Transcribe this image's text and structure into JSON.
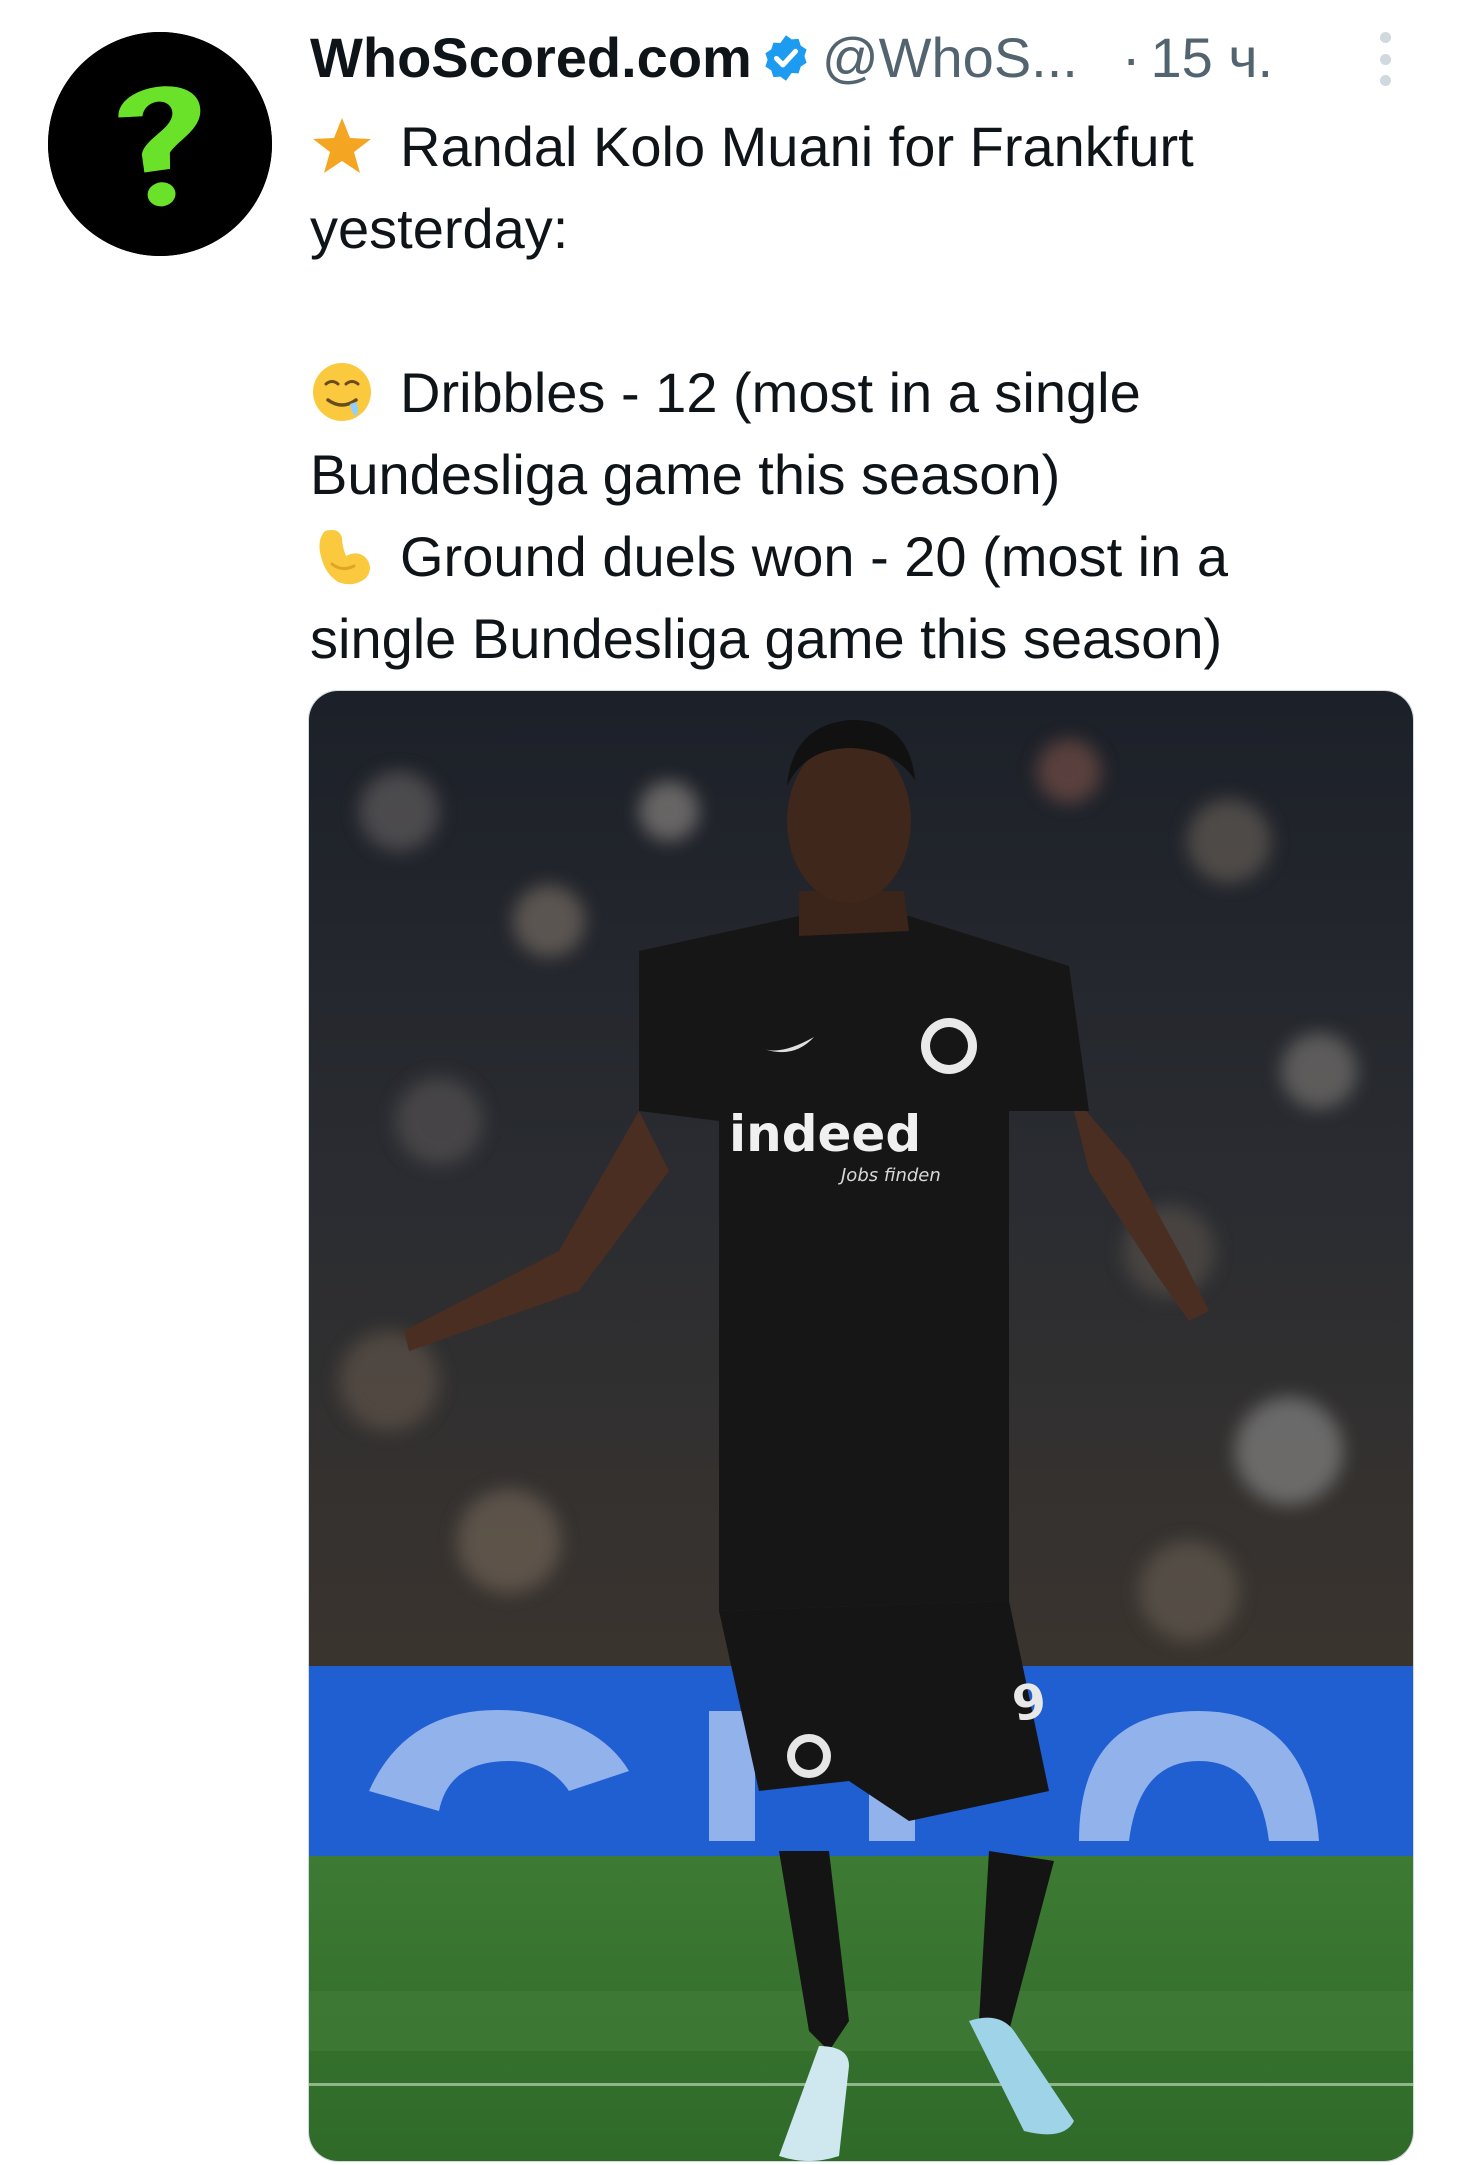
{
  "tweet": {
    "author": {
      "display_name": "WhoScored.com",
      "handle": "@WhoS...",
      "verified": true,
      "avatar_icon": "question-mark-logo-icon",
      "avatar_colors": {
        "background": "#000000",
        "mark": "#6be22a"
      }
    },
    "separator": "·",
    "time": "15 ч.",
    "text": {
      "line1_emoji": "star",
      "line1": "Randal Kolo Muani for Frankfurt",
      "line2": "yesterday:",
      "stat1_emoji": "drooling-face",
      "stat1_line1": "Dribbles - 12 (most in a single",
      "stat1_line2": "Bundesliga game this season)",
      "stat2_emoji": "flexed-biceps",
      "stat2_line1": "Ground duels won - 20 (most in a",
      "stat2_line2": "single Bundesliga game this season)"
    },
    "media": {
      "type": "photo",
      "jersey_sponsor": "indeed",
      "jersey_sponsor_sub": "Jobs finden",
      "shorts_number": "9"
    },
    "colors": {
      "text": "#0f1419",
      "secondary": "#536471",
      "verified": "#1d9bf0",
      "accent_star": "#f4a623"
    }
  }
}
